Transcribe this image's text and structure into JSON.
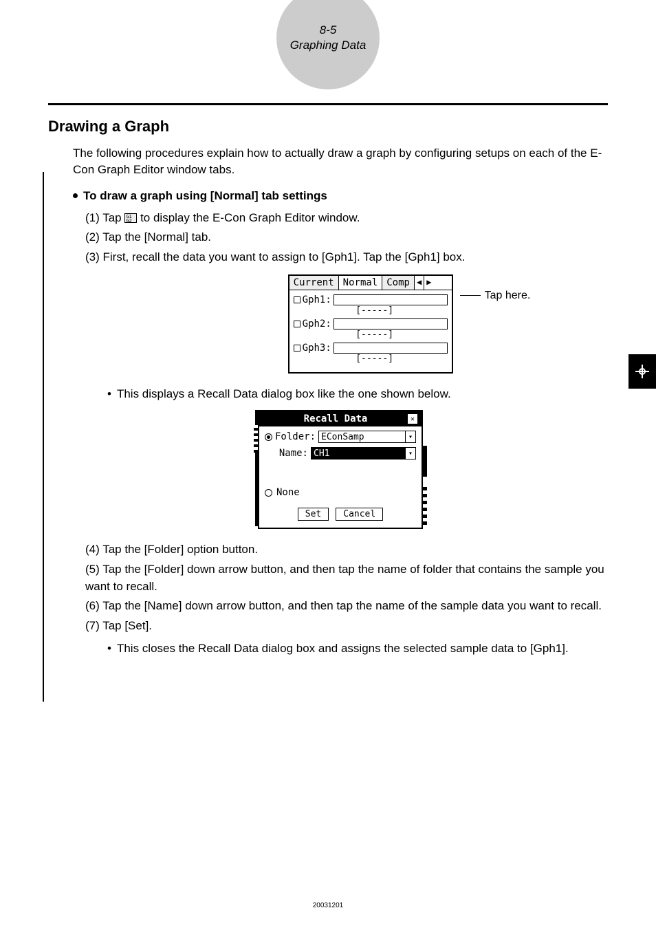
{
  "header": {
    "page_num": "8-5",
    "chapter": "Graphing Data"
  },
  "section_title": "Drawing a Graph",
  "intro": "The following procedures explain how to actually draw a graph by configuring setups on each of the E-Con Graph Editor window tabs.",
  "subhead": "To draw a graph using [Normal] tab settings",
  "steps": {
    "s1_pre": "(1) Tap ",
    "s1_post": " to display the E-Con Graph Editor window.",
    "s2": "(2) Tap the [Normal] tab.",
    "s3": "(3) First, recall the data you want to assign to [Gph1]. Tap the [Gph1] box.",
    "s3_note": "This displays a Recall Data dialog box like the one shown below.",
    "s4": "(4) Tap the [Folder] option button.",
    "s5": "(5) Tap the [Folder] down arrow button, and then tap the name of folder that contains the sample you want to recall.",
    "s6": "(6) Tap the [Name] down arrow button, and then tap the name of the sample data you want to recall.",
    "s7": "(7) Tap [Set].",
    "s7_note": "This closes the Recall Data dialog box and assigns the selected sample data to [Gph1]."
  },
  "fig1": {
    "tabs": [
      "Current",
      "Normal",
      "Comp"
    ],
    "rows": [
      "Gph1:",
      "Gph2:",
      "Gph3:"
    ],
    "placeholder_text": "[-----]",
    "callout": "Tap here."
  },
  "fig2": {
    "title": "Recall Data",
    "folder_label": "Folder:",
    "folder_value": "EConSamp",
    "name_label": "Name:",
    "name_value": "CH1",
    "none_label": "None",
    "set_btn": "Set",
    "cancel_btn": "Cancel"
  },
  "footer_id": "20031201"
}
